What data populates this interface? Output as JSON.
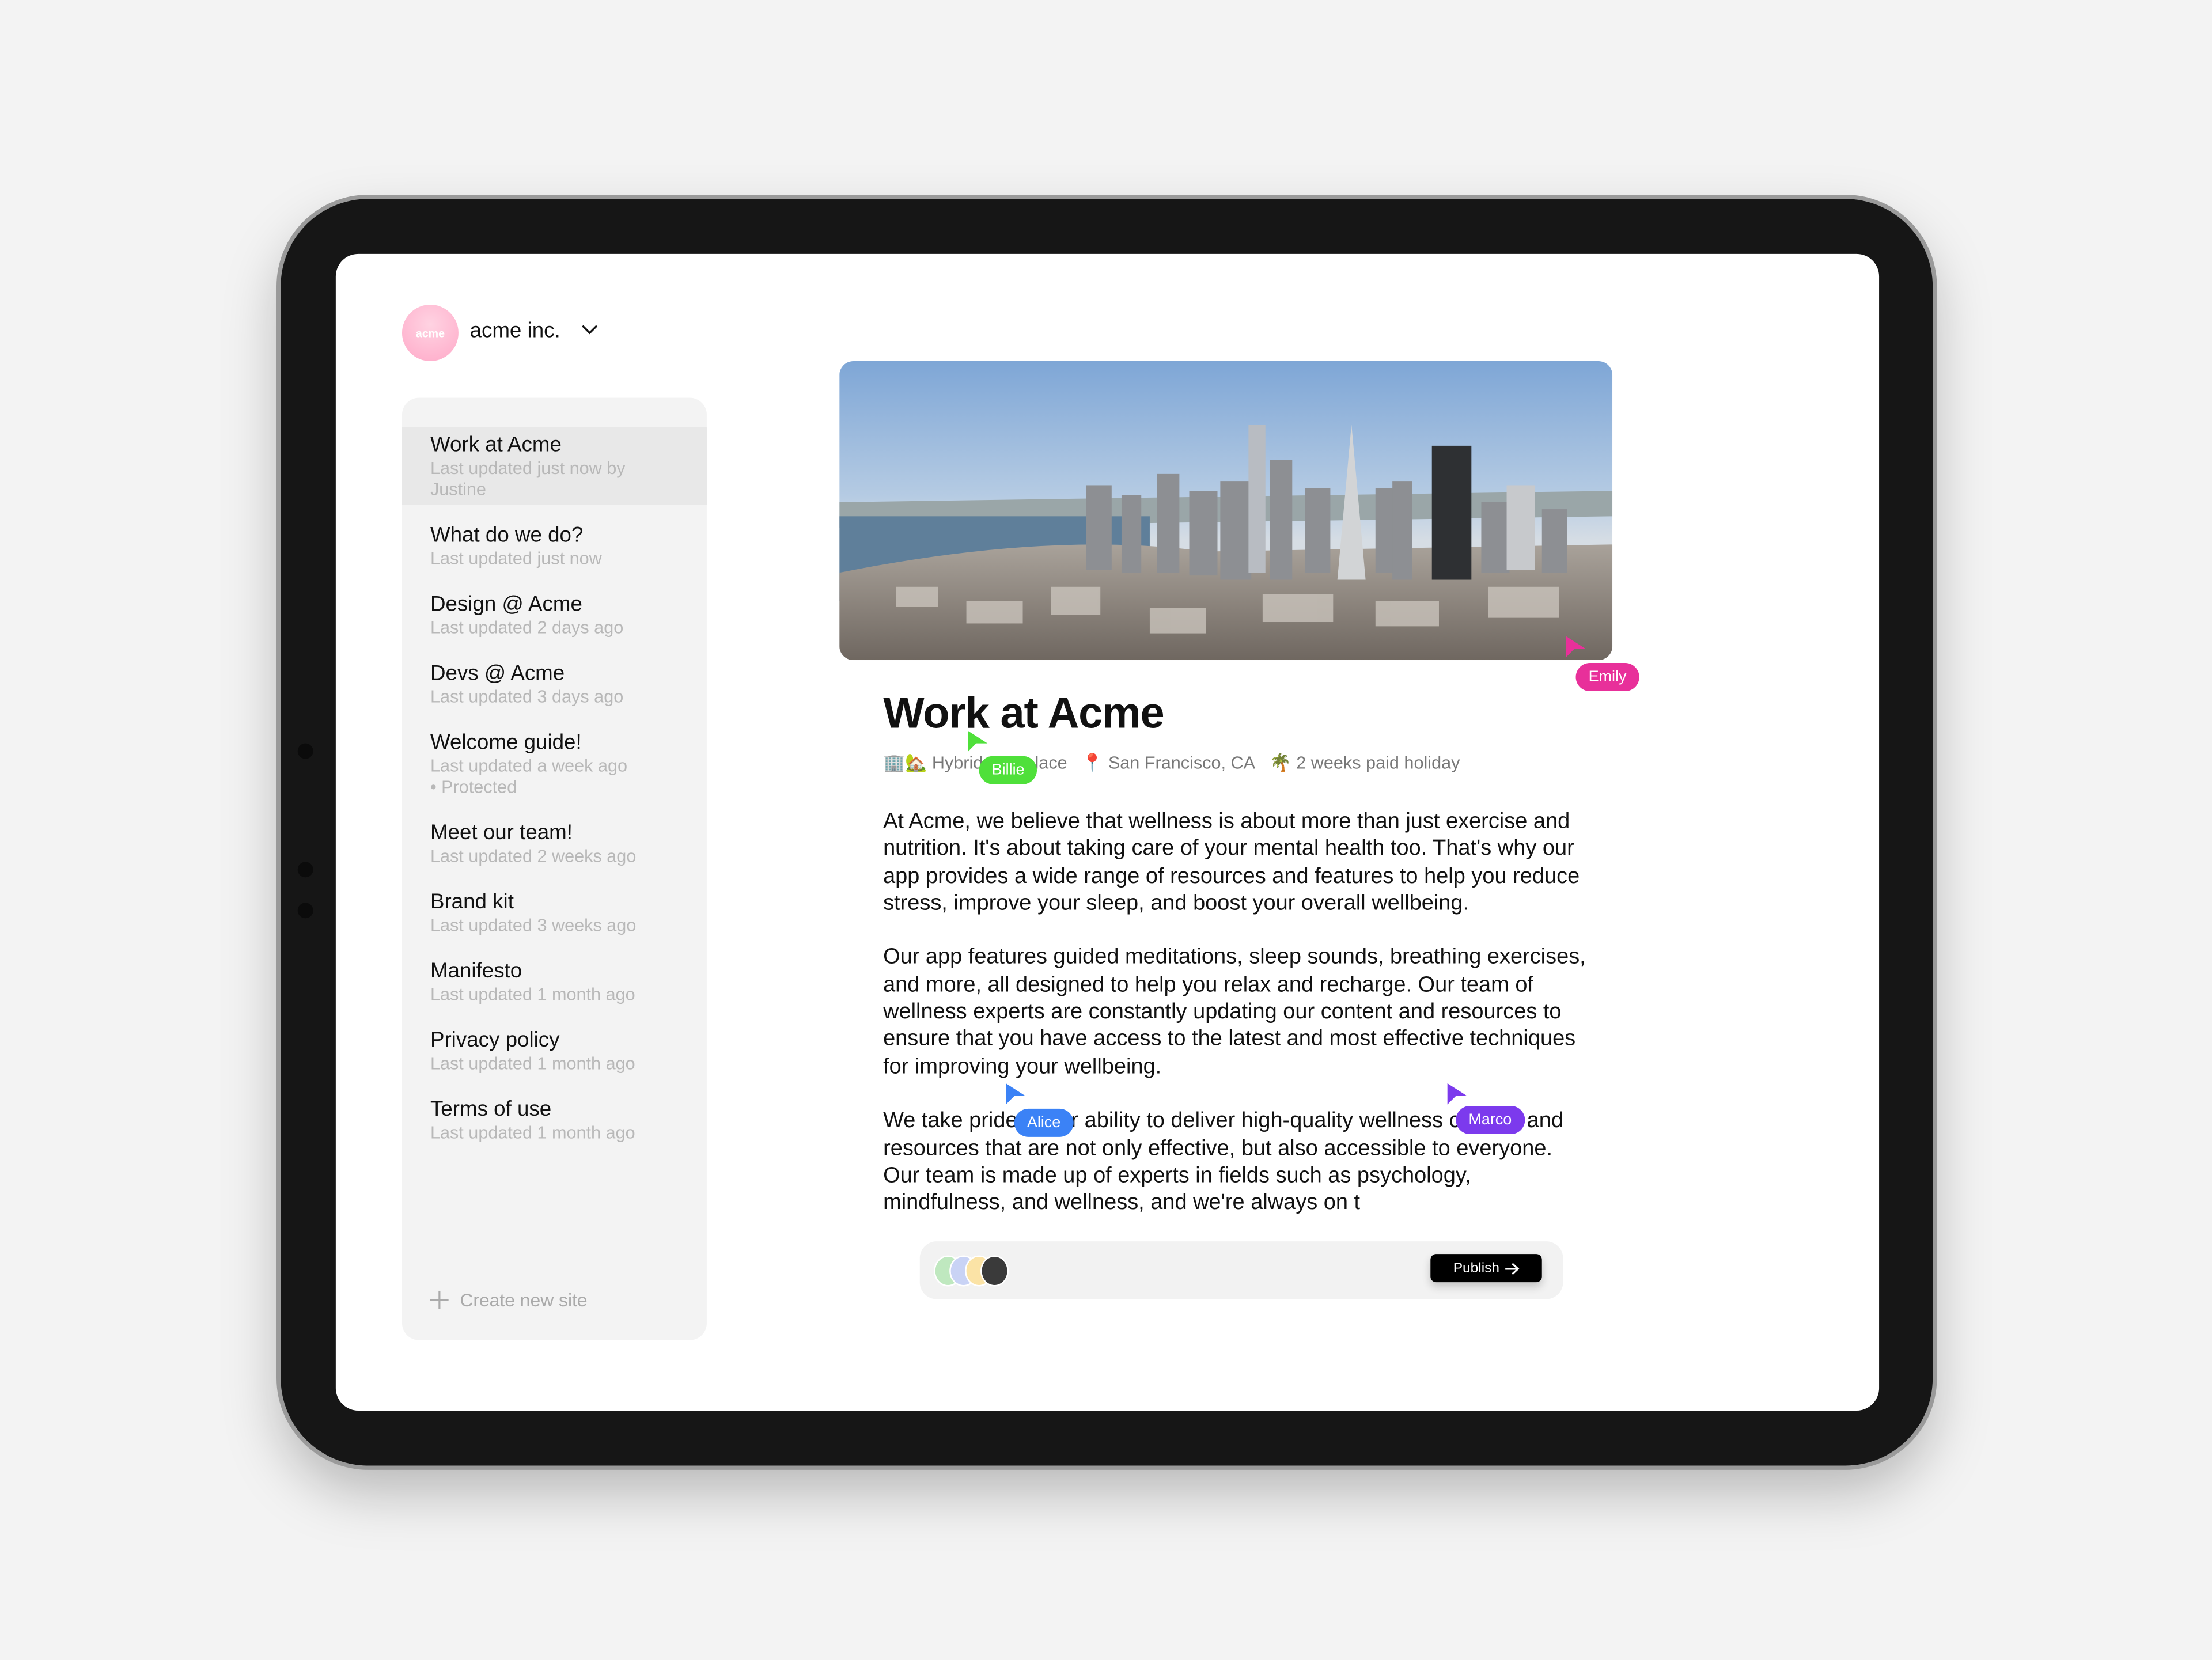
{
  "org": {
    "logo_text": "acme",
    "name": "acme inc."
  },
  "sidebar": {
    "items": [
      {
        "title": "Work at Acme",
        "subtitle": "Last updated just now by Justine",
        "selected": true
      },
      {
        "title": "What do we do?",
        "subtitle": "Last updated just now"
      },
      {
        "title": "Design @ Acme",
        "subtitle": "Last updated 2 days ago"
      },
      {
        "title": "Devs @ Acme",
        "subtitle": "Last updated 3 days ago"
      },
      {
        "title": "Welcome guide!",
        "subtitle": "Last updated a week ago",
        "extra": "• Protected"
      },
      {
        "title": "Meet our team!",
        "subtitle": "Last updated 2 weeks ago"
      },
      {
        "title": "Brand kit",
        "subtitle": "Last updated 3 weeks ago"
      },
      {
        "title": "Manifesto",
        "subtitle": "Last updated 1 month ago"
      },
      {
        "title": "Privacy policy",
        "subtitle": "Last updated 1 month ago"
      },
      {
        "title": "Terms of use",
        "subtitle": "Last updated 1 month ago"
      }
    ],
    "create_label": "Create new site"
  },
  "page": {
    "title": "Work at Acme",
    "meta": [
      {
        "icon": "🏢🏡",
        "text": "Hybrid workplace"
      },
      {
        "icon": "📍",
        "text": "San Francisco, CA"
      },
      {
        "icon": "🌴",
        "text": "2 weeks paid holiday"
      }
    ],
    "paragraphs": [
      "At Acme, we believe that wellness is about more than just exercise and nutrition. It's about taking care of your mental health too. That's why our app provides a wide range of resources and features to help you reduce stress, improve your sleep, and boost your overall wellbeing.",
      "Our app features guided meditations, sleep sounds, breathing exercises, and more, all designed to help you relax and recharge. Our team of wellness experts are constantly updating our content and resources to ensure that you have access to the latest and most effective techniques for improving your wellbeing.",
      "We take pride in our ability to deliver high-quality wellness content and resources that are not only effective, but also accessible to everyone. Our team is made up of experts in fields such as psychology, mindfulness, and wellness, and we're always on t"
    ]
  },
  "bottom_bar": {
    "publish_label": "Publish",
    "publish_icon": "arrow-right"
  },
  "cursors": [
    {
      "name": "Emily",
      "color": "#e8309a"
    },
    {
      "name": "Billie",
      "color": "#4fe03a"
    },
    {
      "name": "Alice",
      "color": "#3b82f6"
    },
    {
      "name": "Marco",
      "color": "#7c3aed"
    }
  ]
}
